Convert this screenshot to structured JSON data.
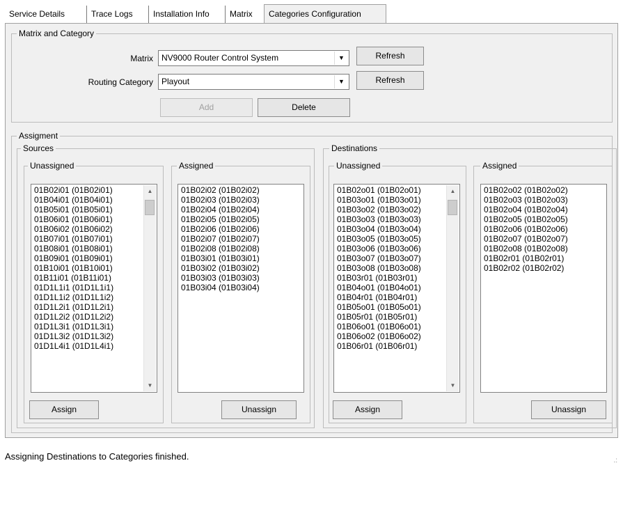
{
  "tabs": [
    "Service Details",
    "Trace Logs",
    "Installation Info",
    "Matrix",
    "Categories Configuration"
  ],
  "matrix_group": {
    "title": "Matrix and Category",
    "matrix_label": "Matrix",
    "matrix_value": "NV9000 Router Control System",
    "category_label": "Routing Category",
    "category_value": "Playout",
    "refresh_label": "Refresh",
    "add_label": "Add",
    "delete_label": "Delete"
  },
  "assignment": {
    "title": "Assigment",
    "sources": {
      "title": "Sources",
      "unassigned_title": "Unassigned",
      "assigned_title": "Assigned",
      "unassigned": [
        "01B02i01 (01B02i01)",
        "01B04i01 (01B04i01)",
        "01B05i01 (01B05i01)",
        "01B06i01 (01B06i01)",
        "01B06i02 (01B06i02)",
        "01B07i01 (01B07i01)",
        "01B08i01 (01B08i01)",
        "01B09i01 (01B09i01)",
        "01B10i01 (01B10i01)",
        "01B11i01 (01B11i01)",
        "01D1L1i1 (01D1L1i1)",
        "01D1L1i2 (01D1L1i2)",
        "01D1L2i1 (01D1L2i1)",
        "01D1L2i2 (01D1L2i2)",
        "01D1L3i1 (01D1L3i1)",
        "01D1L3i2 (01D1L3i2)",
        "01D1L4i1 (01D1L4i1)"
      ],
      "assigned": [
        "01B02i02 (01B02i02)",
        "01B02i03 (01B02i03)",
        "01B02i04 (01B02i04)",
        "01B02i05 (01B02i05)",
        "01B02i06 (01B02i06)",
        "01B02i07 (01B02i07)",
        "01B02i08 (01B02i08)",
        "01B03i01 (01B03i01)",
        "01B03i02 (01B03i02)",
        "01B03i03 (01B03i03)",
        "01B03i04 (01B03i04)"
      ],
      "assign_label": "Assign",
      "unassign_label": "Unassign"
    },
    "destinations": {
      "title": "Destinations",
      "unassigned_title": "Unassigned",
      "assigned_title": "Assigned",
      "unassigned": [
        "01B02o01 (01B02o01)",
        "01B03o01 (01B03o01)",
        "01B03o02 (01B03o02)",
        "01B03o03 (01B03o03)",
        "01B03o04 (01B03o04)",
        "01B03o05 (01B03o05)",
        "01B03o06 (01B03o06)",
        "01B03o07 (01B03o07)",
        "01B03o08 (01B03o08)",
        "01B03r01 (01B03r01)",
        "01B04o01 (01B04o01)",
        "01B04r01 (01B04r01)",
        "01B05o01 (01B05o01)",
        "01B05r01 (01B05r01)",
        "01B06o01 (01B06o01)",
        "01B06o02 (01B06o02)",
        "01B06r01 (01B06r01)"
      ],
      "assigned": [
        "01B02o02 (01B02o02)",
        "01B02o03 (01B02o03)",
        "01B02o04 (01B02o04)",
        "01B02o05 (01B02o05)",
        "01B02o06 (01B02o06)",
        "01B02o07 (01B02o07)",
        "01B02o08 (01B02o08)",
        "01B02r01 (01B02r01)",
        "01B02r02 (01B02r02)"
      ],
      "assign_label": "Assign",
      "unassign_label": "Unassign"
    }
  },
  "status": {
    "text": "Assigning Destinations to Categories finished.",
    "grip": ".:"
  },
  "icons": {
    "dropdown": "chevron-down-icon",
    "scroll_up": "scroll-up-icon",
    "scroll_down": "scroll-down-icon"
  }
}
